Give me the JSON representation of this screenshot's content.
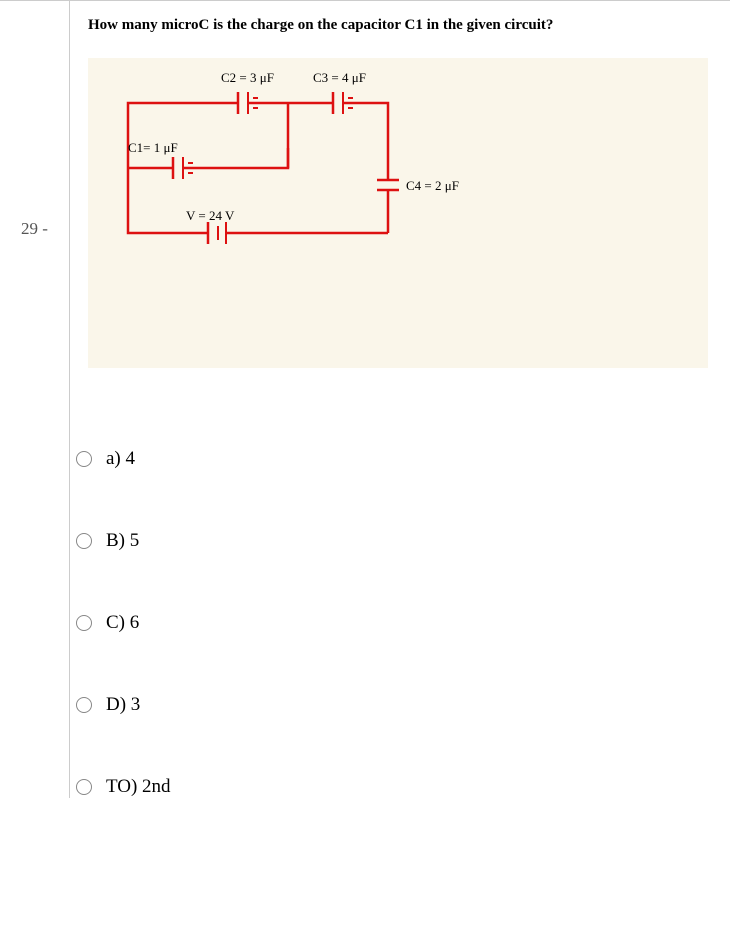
{
  "question": {
    "number": "29 -",
    "text": "How many microC is the charge on the capacitor C1 in the given circuit?"
  },
  "circuit": {
    "c1": "C1= 1 μF",
    "c2": "C2 = 3 μF",
    "c3": "C3 = 4 μF",
    "c4": "C4 = 2 μF",
    "v": "V = 24 V"
  },
  "options": {
    "a": "a)  4",
    "b": "B)  5",
    "c": "C)  6",
    "d": "D)  3",
    "to": "TO)  2nd"
  }
}
